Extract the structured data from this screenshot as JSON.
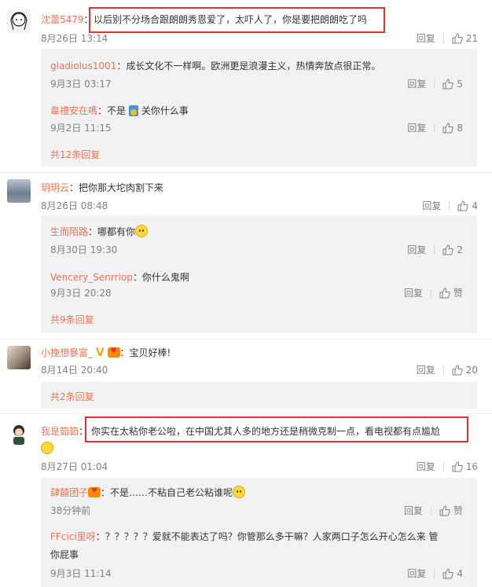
{
  "comments": [
    {
      "author": "沈蕾5479",
      "text": "以后别不分场合跟朗朗秀恩爱了，太吓人了，你是要把朗朗吃了吗",
      "time": "8月26日 13:14",
      "reply": "回复",
      "likes": "21",
      "replies": [
        {
          "author": "gladiolus1001",
          "text": "成长文化不一样啊。欧洲更是浪漫主义，热情奔放点很正常。",
          "time": "9月3日 03:17",
          "reply": "回复",
          "likes": "5"
        },
        {
          "author": "韋禮安在嗎",
          "text_a": "不是",
          "text_b": "关你什么事",
          "time": "9月2日 11:15",
          "reply": "回复",
          "likes": "8"
        }
      ],
      "more": "共12条回复"
    },
    {
      "author": "玥玥云",
      "text": "把你那大坨肉割下来",
      "time": "8月26日 08:48",
      "reply": "回复",
      "likes": "4",
      "replies": [
        {
          "author": "生而陌路",
          "text": "哪都有你",
          "time": "8月30日 19:30",
          "reply": "回复",
          "likes": "2"
        },
        {
          "author": "Vencery_Senrriop",
          "text": "你什么鬼啊",
          "time": "9月3日 20:28",
          "reply": "回复",
          "likes": "赞"
        }
      ],
      "more": "共9条回复"
    },
    {
      "author": "小挽想暴富_",
      "badge": "V",
      "text": "宝贝好棒!",
      "time": "8月14日 20:40",
      "reply": "回复",
      "likes": "20",
      "replies": [],
      "more": "共2条回复"
    },
    {
      "author": "我是筎筎",
      "text": "你实在太粘你老公啦，在中国尤其人多的地方还是稍微克制一点，看电视都有点尴尬",
      "time": "8月27日 01:04",
      "reply": "回复",
      "likes": "16",
      "replies": [
        {
          "author": "肆囍团子",
          "text": "不是……不粘自己老公粘谁呢",
          "time": "38分钟前",
          "reply": "回复",
          "likes": "赞"
        },
        {
          "author": "FFcici里呀",
          "text": "？？？？？爱就不能表达了吗？你管那么多干嘛？人家两口子怎么开心怎么来 管",
          "text2": "你屁事",
          "time": "9月3日 11:14",
          "reply": "回复",
          "likes": "4"
        }
      ]
    }
  ],
  "colon": "：",
  "colors": {
    "author": "#eb7350",
    "highlight": "#e8312f",
    "subbg": "#f2f2f5"
  }
}
